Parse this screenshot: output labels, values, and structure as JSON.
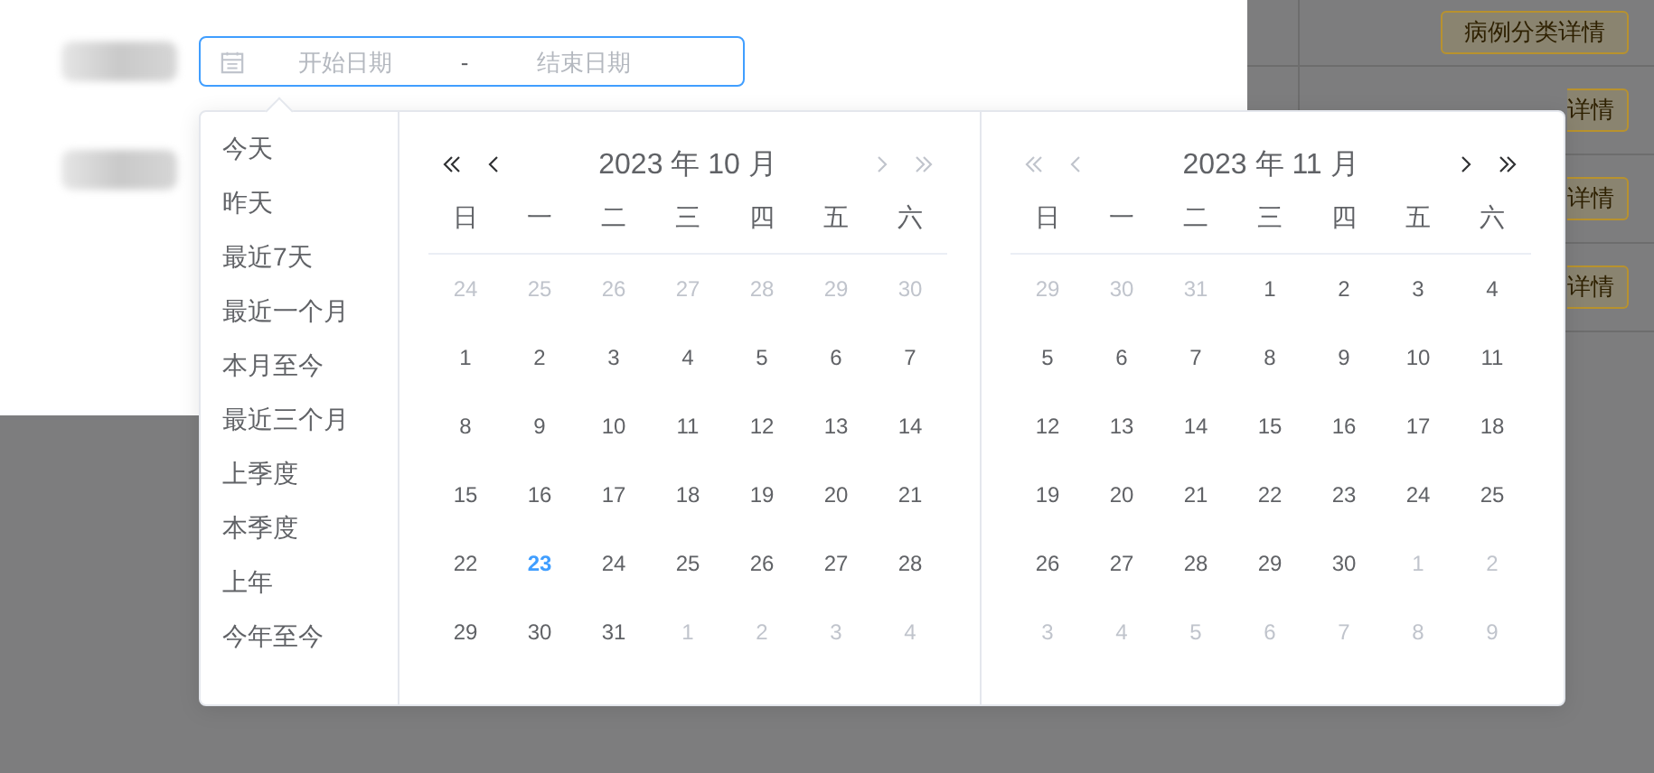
{
  "background_table": {
    "buttons": [
      {
        "label": "病例分类详情"
      },
      {
        "label": "详情"
      },
      {
        "label": "详情"
      },
      {
        "label": "详情"
      }
    ]
  },
  "date_range": {
    "start_placeholder": "开始日期",
    "separator": "-",
    "end_placeholder": "结束日期"
  },
  "shortcuts": [
    "今天",
    "昨天",
    "最近7天",
    "最近一个月",
    "本月至今",
    "最近三个月",
    "上季度",
    "本季度",
    "上年",
    "今年至今"
  ],
  "panels": [
    {
      "title": "2023 年 10 月",
      "nav": [
        {
          "kind": "prev-year",
          "disabled": false
        },
        {
          "kind": "prev-month",
          "disabled": false
        },
        {
          "kind": "next-month",
          "disabled": true
        },
        {
          "kind": "next-year",
          "disabled": true
        }
      ],
      "weekdays": [
        "日",
        "一",
        "二",
        "三",
        "四",
        "五",
        "六"
      ],
      "weeks": [
        [
          {
            "d": "24",
            "kind": "other"
          },
          {
            "d": "25",
            "kind": "other"
          },
          {
            "d": "26",
            "kind": "other"
          },
          {
            "d": "27",
            "kind": "other"
          },
          {
            "d": "28",
            "kind": "other"
          },
          {
            "d": "29",
            "kind": "other"
          },
          {
            "d": "30",
            "kind": "other"
          }
        ],
        [
          {
            "d": "1",
            "kind": "current"
          },
          {
            "d": "2",
            "kind": "current"
          },
          {
            "d": "3",
            "kind": "current"
          },
          {
            "d": "4",
            "kind": "current"
          },
          {
            "d": "5",
            "kind": "current"
          },
          {
            "d": "6",
            "kind": "current"
          },
          {
            "d": "7",
            "kind": "current"
          }
        ],
        [
          {
            "d": "8",
            "kind": "current"
          },
          {
            "d": "9",
            "kind": "current"
          },
          {
            "d": "10",
            "kind": "current"
          },
          {
            "d": "11",
            "kind": "current"
          },
          {
            "d": "12",
            "kind": "current"
          },
          {
            "d": "13",
            "kind": "current"
          },
          {
            "d": "14",
            "kind": "current"
          }
        ],
        [
          {
            "d": "15",
            "kind": "current"
          },
          {
            "d": "16",
            "kind": "current"
          },
          {
            "d": "17",
            "kind": "current"
          },
          {
            "d": "18",
            "kind": "current"
          },
          {
            "d": "19",
            "kind": "current"
          },
          {
            "d": "20",
            "kind": "current"
          },
          {
            "d": "21",
            "kind": "current"
          }
        ],
        [
          {
            "d": "22",
            "kind": "current"
          },
          {
            "d": "23",
            "kind": "today"
          },
          {
            "d": "24",
            "kind": "current"
          },
          {
            "d": "25",
            "kind": "current"
          },
          {
            "d": "26",
            "kind": "current"
          },
          {
            "d": "27",
            "kind": "current"
          },
          {
            "d": "28",
            "kind": "current"
          }
        ],
        [
          {
            "d": "29",
            "kind": "current"
          },
          {
            "d": "30",
            "kind": "current"
          },
          {
            "d": "31",
            "kind": "current"
          },
          {
            "d": "1",
            "kind": "other"
          },
          {
            "d": "2",
            "kind": "other"
          },
          {
            "d": "3",
            "kind": "other"
          },
          {
            "d": "4",
            "kind": "other"
          }
        ]
      ]
    },
    {
      "title": "2023 年 11 月",
      "nav": [
        {
          "kind": "prev-year",
          "disabled": true
        },
        {
          "kind": "prev-month",
          "disabled": true
        },
        {
          "kind": "next-month",
          "disabled": false
        },
        {
          "kind": "next-year",
          "disabled": false
        }
      ],
      "weekdays": [
        "日",
        "一",
        "二",
        "三",
        "四",
        "五",
        "六"
      ],
      "weeks": [
        [
          {
            "d": "29",
            "kind": "other"
          },
          {
            "d": "30",
            "kind": "other"
          },
          {
            "d": "31",
            "kind": "other"
          },
          {
            "d": "1",
            "kind": "current"
          },
          {
            "d": "2",
            "kind": "current"
          },
          {
            "d": "3",
            "kind": "current"
          },
          {
            "d": "4",
            "kind": "current"
          }
        ],
        [
          {
            "d": "5",
            "kind": "current"
          },
          {
            "d": "6",
            "kind": "current"
          },
          {
            "d": "7",
            "kind": "current"
          },
          {
            "d": "8",
            "kind": "current"
          },
          {
            "d": "9",
            "kind": "current"
          },
          {
            "d": "10",
            "kind": "current"
          },
          {
            "d": "11",
            "kind": "current"
          }
        ],
        [
          {
            "d": "12",
            "kind": "current"
          },
          {
            "d": "13",
            "kind": "current"
          },
          {
            "d": "14",
            "kind": "current"
          },
          {
            "d": "15",
            "kind": "current"
          },
          {
            "d": "16",
            "kind": "current"
          },
          {
            "d": "17",
            "kind": "current"
          },
          {
            "d": "18",
            "kind": "current"
          }
        ],
        [
          {
            "d": "19",
            "kind": "current"
          },
          {
            "d": "20",
            "kind": "current"
          },
          {
            "d": "21",
            "kind": "current"
          },
          {
            "d": "22",
            "kind": "current"
          },
          {
            "d": "23",
            "kind": "current"
          },
          {
            "d": "24",
            "kind": "current"
          },
          {
            "d": "25",
            "kind": "current"
          }
        ],
        [
          {
            "d": "26",
            "kind": "current"
          },
          {
            "d": "27",
            "kind": "current"
          },
          {
            "d": "28",
            "kind": "current"
          },
          {
            "d": "29",
            "kind": "current"
          },
          {
            "d": "30",
            "kind": "current"
          },
          {
            "d": "1",
            "kind": "other"
          },
          {
            "d": "2",
            "kind": "other"
          }
        ],
        [
          {
            "d": "3",
            "kind": "other"
          },
          {
            "d": "4",
            "kind": "other"
          },
          {
            "d": "5",
            "kind": "other"
          },
          {
            "d": "6",
            "kind": "other"
          },
          {
            "d": "7",
            "kind": "other"
          },
          {
            "d": "8",
            "kind": "other"
          },
          {
            "d": "9",
            "kind": "other"
          }
        ]
      ]
    }
  ]
}
